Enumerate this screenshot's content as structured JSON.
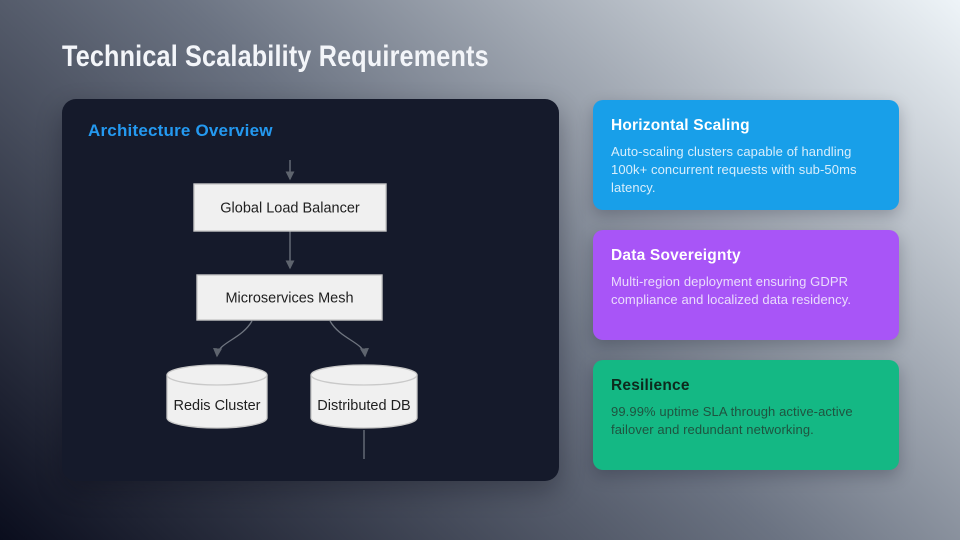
{
  "slide": {
    "title": "Technical Scalability Requirements"
  },
  "architecture": {
    "heading": "Architecture Overview",
    "nodes": {
      "load_balancer": "Global Load Balancer",
      "mesh": "Microservices Mesh",
      "redis": "Redis Cluster",
      "db": "Distributed DB"
    }
  },
  "cards": [
    {
      "title": "Horizontal Scaling",
      "body": "Auto-scaling clusters capable of handling 100k+ concurrent requests with sub-50ms latency.",
      "bg": "#189FE9",
      "title_color": "#FFFFFF",
      "body_color": "#D8EEFC"
    },
    {
      "title": "Data Sovereignty",
      "body": "Multi-region deployment ensuring GDPR compliance and localized data residency.",
      "bg": "#A855F7",
      "title_color": "#FFFFFF",
      "body_color": "#EADCFC"
    },
    {
      "title": "Resilience",
      "body": "99.99% uptime SLA through active-active failover and redundant networking.",
      "bg": "#14B884",
      "title_color": "#0D2A1D",
      "body_color": "#1F5440"
    }
  ],
  "colors": {
    "background_dark": "#0A0D1D",
    "background_mid": "#6B7382",
    "background_light": "#EEF4F8",
    "panel_bg": "#151A2B",
    "heading_accent": "#2499F0",
    "title_text": "#F3F5F9",
    "node_fill": "#F0F0F0",
    "node_border": "#C9C9C9",
    "node_text": "#1F1F1F",
    "edge": "#6F7580",
    "arrowhead": "#5E646E"
  }
}
